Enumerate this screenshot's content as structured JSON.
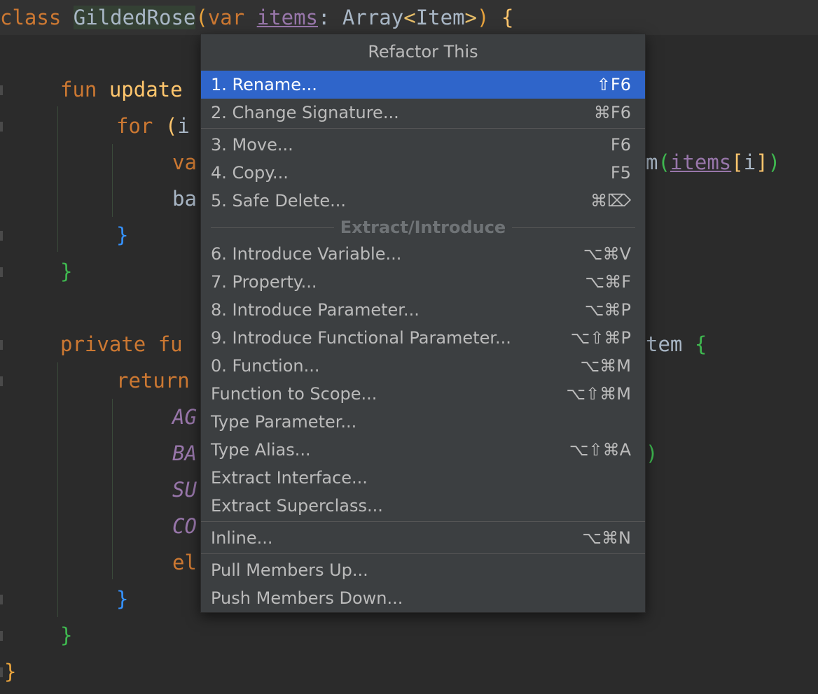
{
  "editor": {
    "lines": [
      {
        "tokens": [
          [
            "kw",
            "class "
          ],
          [
            "cls-hl",
            "GildedRose"
          ],
          [
            "br-o",
            "("
          ],
          [
            "kw",
            "var "
          ],
          [
            "prop",
            "items"
          ],
          [
            "plain",
            ": Array"
          ],
          [
            "gen",
            "<"
          ],
          [
            "plain",
            "Item"
          ],
          [
            "gen",
            ">"
          ],
          [
            "br-o",
            ")"
          ],
          [
            "plain",
            " "
          ],
          [
            "br-y",
            "{"
          ]
        ]
      },
      {
        "tokens": [
          [
            "kw",
            "fun "
          ],
          [
            "br-y",
            "update"
          ]
        ]
      },
      {
        "tokens": [
          [
            "kw",
            "for "
          ],
          [
            "br-y",
            "("
          ],
          [
            "plain",
            "i"
          ]
        ]
      },
      {
        "tokens": [
          [
            "kw",
            "va"
          ]
        ]
      },
      {
        "tokens": [
          [
            "plain",
            "ba"
          ]
        ]
      },
      {
        "tokens": [
          [
            "br-b",
            "}"
          ]
        ]
      },
      {
        "tokens": [
          [
            "br-g",
            "}"
          ]
        ]
      },
      {
        "tokens": [
          [
            "kw",
            "private "
          ],
          [
            "kw",
            "fu"
          ]
        ]
      },
      {
        "tokens": [
          [
            "kw",
            "return"
          ]
        ]
      },
      {
        "tokens": [
          [
            "const",
            "AG"
          ]
        ]
      },
      {
        "tokens": [
          [
            "const",
            "BA"
          ]
        ]
      },
      {
        "tokens": [
          [
            "const",
            "SU"
          ]
        ]
      },
      {
        "tokens": [
          [
            "const",
            "CO"
          ]
        ]
      },
      {
        "tokens": [
          [
            "kw",
            "el"
          ]
        ]
      },
      {
        "tokens": [
          [
            "br-b",
            "}"
          ]
        ]
      },
      {
        "tokens": [
          [
            "br-g",
            "}"
          ]
        ]
      },
      {
        "tokens": [
          [
            "br-o",
            "}"
          ]
        ]
      }
    ],
    "right_fragments": {
      "line3": [
        [
          "plain",
          "m"
        ],
        [
          "br-g",
          "("
        ],
        [
          "prop",
          "items"
        ],
        [
          "br-y",
          "["
        ],
        [
          "plain",
          "i"
        ],
        [
          "br-y",
          "]"
        ],
        [
          "br-g",
          ")"
        ]
      ],
      "line7": [
        [
          "plain",
          "tem "
        ],
        [
          "br-g",
          "{"
        ]
      ],
      "line10": [
        [
          "br-g",
          ")"
        ]
      ]
    }
  },
  "popup": {
    "title": "Refactor This",
    "group_extract": "Extract/Introduce",
    "items": [
      {
        "label": "1. Rename...",
        "shortcut": "⇧F6",
        "selected": true
      },
      {
        "label": "2. Change Signature...",
        "shortcut": "⌘F6"
      },
      {
        "label": "3. Move...",
        "shortcut": "F6"
      },
      {
        "label": "4. Copy...",
        "shortcut": "F5"
      },
      {
        "label": "5. Safe Delete...",
        "shortcut": "⌘⌦"
      },
      {
        "label": "6. Introduce Variable...",
        "shortcut": "⌥⌘V"
      },
      {
        "label": "7. Property...",
        "shortcut": "⌥⌘F"
      },
      {
        "label": "8. Introduce Parameter...",
        "shortcut": "⌥⌘P"
      },
      {
        "label": "9. Introduce Functional Parameter...",
        "shortcut": "⌥⇧⌘P"
      },
      {
        "label": "0. Function...",
        "shortcut": "⌥⌘M"
      },
      {
        "label": "Function to Scope...",
        "shortcut": "⌥⇧⌘M"
      },
      {
        "label": "Type Parameter...",
        "shortcut": ""
      },
      {
        "label": "Type Alias...",
        "shortcut": "⌥⇧⌘A"
      },
      {
        "label": "Extract Interface...",
        "shortcut": ""
      },
      {
        "label": "Extract Superclass...",
        "shortcut": ""
      },
      {
        "label": "Inline...",
        "shortcut": "⌥⌘N"
      },
      {
        "label": "Pull Members Up...",
        "shortcut": ""
      },
      {
        "label": "Push Members Down...",
        "shortcut": ""
      }
    ]
  }
}
